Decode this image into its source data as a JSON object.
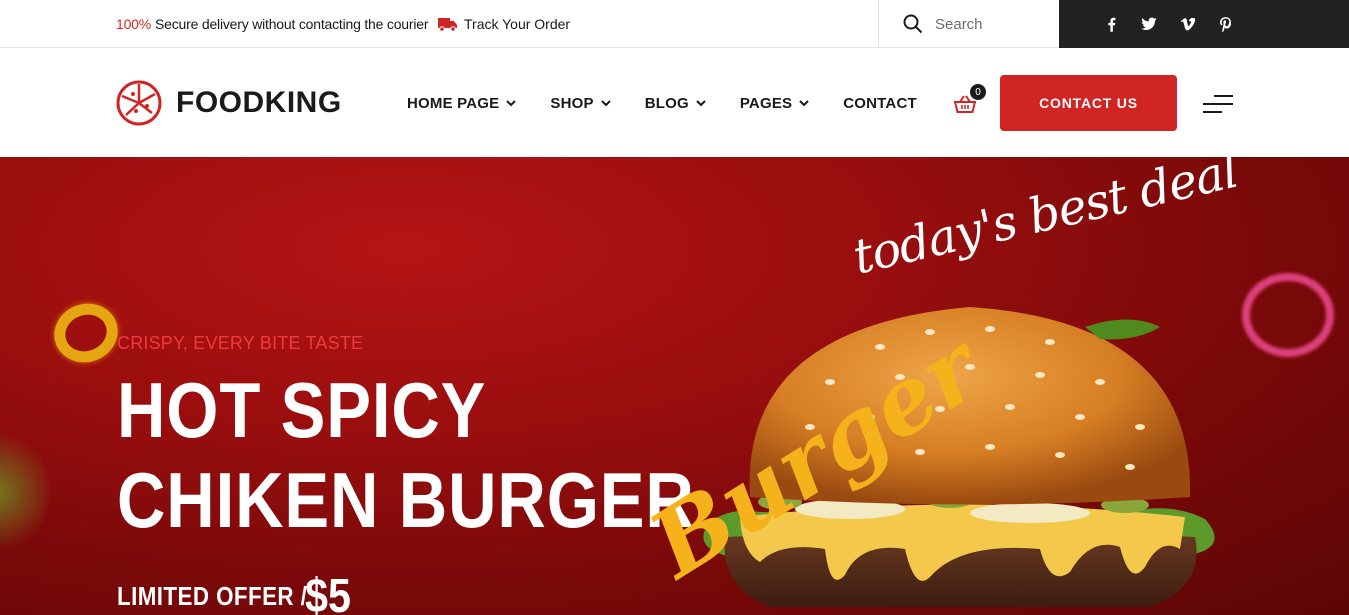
{
  "topbar": {
    "promo_percent": "100%",
    "promo_text": "Secure delivery without contacting the courier",
    "track_label": "Track Your Order",
    "search_placeholder": "Search",
    "social": [
      "facebook-icon",
      "twitter-icon",
      "vimeo-icon",
      "pinterest-icon"
    ]
  },
  "header": {
    "logo_text": "FOODKING",
    "nav": [
      {
        "label": "HOME PAGE",
        "dropdown": true
      },
      {
        "label": "SHOP",
        "dropdown": true
      },
      {
        "label": "BLOG",
        "dropdown": true
      },
      {
        "label": "PAGES",
        "dropdown": true
      },
      {
        "label": "CONTACT",
        "dropdown": false
      }
    ],
    "cart_count": "0",
    "contact_button": "CONTACT US"
  },
  "hero": {
    "subtitle": "CRISPY, EVERY BITE TASTE",
    "title_line1": "HOT SPICY",
    "title_line2": "CHIKEN BURGER",
    "offer_label": "LIMITED OFFER /",
    "price": "$5",
    "deal_script": "today's best deal",
    "burger_word": "Burger"
  },
  "colors": {
    "accent": "#d12525",
    "dark": "#222222",
    "hero_bg": "#9a0e0e",
    "bun": "#d9862c"
  }
}
